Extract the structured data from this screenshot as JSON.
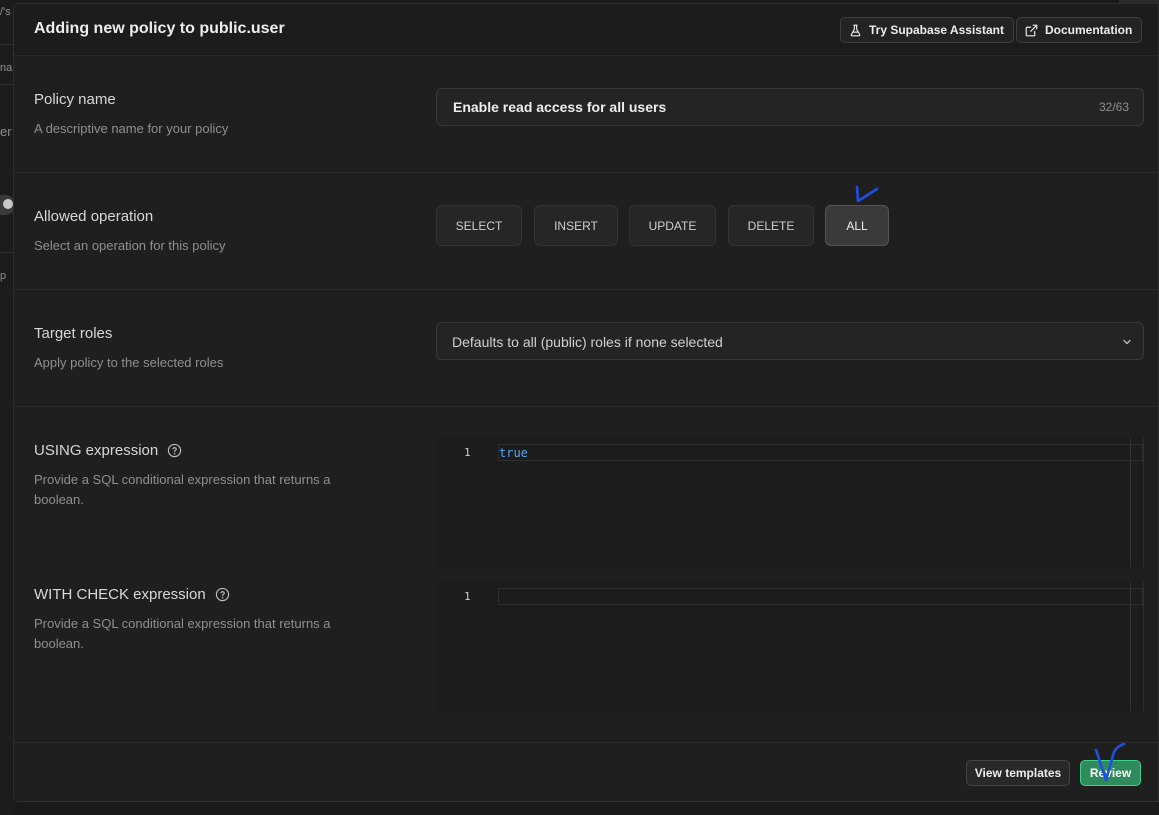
{
  "background": {
    "fragments": [
      "/'s",
      "na",
      "er",
      "p"
    ]
  },
  "header": {
    "title": "Adding new policy to public.user",
    "assistant_label": "Try Supabase Assistant",
    "docs_label": "Documentation"
  },
  "policy_name": {
    "label": "Policy name",
    "description": "A descriptive name for your policy",
    "value": "Enable read access for all users",
    "char_count": "32/63"
  },
  "allowed_operation": {
    "label": "Allowed operation",
    "description": "Select an operation for this policy",
    "options": [
      "SELECT",
      "INSERT",
      "UPDATE",
      "DELETE",
      "ALL"
    ],
    "selected": "ALL"
  },
  "target_roles": {
    "label": "Target roles",
    "description": "Apply policy to the selected roles",
    "placeholder": "Defaults to all (public) roles if none selected"
  },
  "using_expression": {
    "label": "USING expression",
    "description": "Provide a SQL conditional expression that returns a boolean.",
    "line_number": "1",
    "code": "true"
  },
  "with_check_expression": {
    "label": "WITH CHECK expression",
    "description": "Provide a SQL conditional expression that returns a boolean.",
    "line_number": "1",
    "code": ""
  },
  "footer": {
    "templates_label": "View templates",
    "review_label": "Review"
  },
  "colors": {
    "accent_green": "#3ecf8e",
    "code_keyword": "#5aa6f0",
    "annotation_blue": "#1f4fe0"
  }
}
